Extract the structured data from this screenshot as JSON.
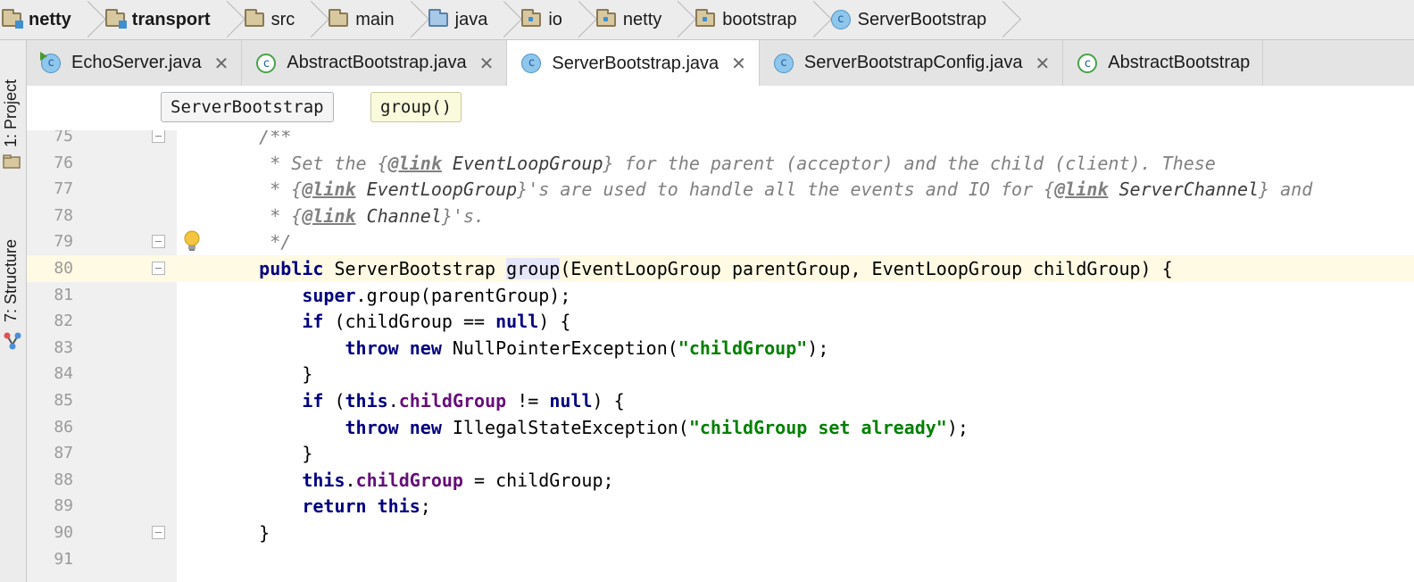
{
  "breadcrumb": [
    {
      "label": "netty",
      "icon": "module-folder-icon",
      "bold": true
    },
    {
      "label": "transport",
      "icon": "module-folder-icon",
      "bold": true
    },
    {
      "label": "src",
      "icon": "folder-icon"
    },
    {
      "label": "main",
      "icon": "folder-icon"
    },
    {
      "label": "java",
      "icon": "source-folder-icon"
    },
    {
      "label": "io",
      "icon": "package-icon"
    },
    {
      "label": "netty",
      "icon": "package-icon"
    },
    {
      "label": "bootstrap",
      "icon": "package-icon"
    },
    {
      "label": "ServerBootstrap",
      "icon": "class-icon"
    }
  ],
  "tool_windows": {
    "project": "1: Project",
    "structure": "7: Structure"
  },
  "tabs": [
    {
      "label": "EchoServer.java",
      "icon": "runnable-class-icon",
      "active": false
    },
    {
      "label": "AbstractBootstrap.java",
      "icon": "abstract-class-icon",
      "active": false
    },
    {
      "label": "ServerBootstrap.java",
      "icon": "class-icon",
      "active": true
    },
    {
      "label": "ServerBootstrapConfig.java",
      "icon": "class-icon",
      "active": false
    },
    {
      "label": "AbstractBootstrap",
      "icon": "abstract-class-icon",
      "active": false
    }
  ],
  "context": {
    "class_name": "ServerBootstrap",
    "method_name": "group()"
  },
  "editor": {
    "current_line": 80,
    "lines": [
      {
        "n": "75",
        "segs": [
          {
            "t": "    /**",
            "c": "cmt"
          }
        ]
      },
      {
        "n": "76",
        "segs": [
          {
            "t": "     * Set the {",
            "c": "cmt"
          },
          {
            "t": "@link",
            "c": "tag"
          },
          {
            "t": " ",
            "c": "cmt"
          },
          {
            "t": "EventLoopGroup",
            "c": "ref"
          },
          {
            "t": "} for the parent (acceptor) and the child (client). These",
            "c": "cmt"
          }
        ]
      },
      {
        "n": "77",
        "segs": [
          {
            "t": "     * {",
            "c": "cmt"
          },
          {
            "t": "@link",
            "c": "tag"
          },
          {
            "t": " ",
            "c": "cmt"
          },
          {
            "t": "EventLoopGroup",
            "c": "ref"
          },
          {
            "t": "}'s are used to handle all the events and IO for {",
            "c": "cmt"
          },
          {
            "t": "@link",
            "c": "tag"
          },
          {
            "t": " ",
            "c": "cmt"
          },
          {
            "t": "ServerChannel",
            "c": "ref"
          },
          {
            "t": "} and",
            "c": "cmt"
          }
        ]
      },
      {
        "n": "78",
        "segs": [
          {
            "t": "     * {",
            "c": "cmt"
          },
          {
            "t": "@link",
            "c": "tag"
          },
          {
            "t": " ",
            "c": "cmt"
          },
          {
            "t": "Channel",
            "c": "ref"
          },
          {
            "t": "}'s.",
            "c": "cmt"
          }
        ]
      },
      {
        "n": "79",
        "segs": [
          {
            "t": "     */",
            "c": "cmt"
          }
        ]
      },
      {
        "n": "80",
        "segs": [
          {
            "t": "    ",
            "c": ""
          },
          {
            "t": "public",
            "c": "kw"
          },
          {
            "t": " ServerBootstrap ",
            "c": ""
          },
          {
            "t": "group",
            "c": "usage"
          },
          {
            "t": "(EventLoopGroup parentGroup, EventLoopGroup childGroup) {",
            "c": ""
          }
        ]
      },
      {
        "n": "81",
        "segs": [
          {
            "t": "        ",
            "c": ""
          },
          {
            "t": "super",
            "c": "kw"
          },
          {
            "t": ".group(parentGroup);",
            "c": ""
          }
        ]
      },
      {
        "n": "82",
        "segs": [
          {
            "t": "        ",
            "c": ""
          },
          {
            "t": "if",
            "c": "kw"
          },
          {
            "t": " (childGroup == ",
            "c": ""
          },
          {
            "t": "null",
            "c": "kw"
          },
          {
            "t": ") {",
            "c": ""
          }
        ]
      },
      {
        "n": "83",
        "segs": [
          {
            "t": "            ",
            "c": ""
          },
          {
            "t": "throw new",
            "c": "kw"
          },
          {
            "t": " NullPointerException(",
            "c": ""
          },
          {
            "t": "\"childGroup\"",
            "c": "str"
          },
          {
            "t": ");",
            "c": ""
          }
        ]
      },
      {
        "n": "84",
        "segs": [
          {
            "t": "        }",
            "c": ""
          }
        ]
      },
      {
        "n": "85",
        "segs": [
          {
            "t": "        ",
            "c": ""
          },
          {
            "t": "if",
            "c": "kw"
          },
          {
            "t": " (",
            "c": ""
          },
          {
            "t": "this",
            "c": "kw"
          },
          {
            "t": ".",
            "c": ""
          },
          {
            "t": "childGroup",
            "c": "fld"
          },
          {
            "t": " != ",
            "c": ""
          },
          {
            "t": "null",
            "c": "kw"
          },
          {
            "t": ") {",
            "c": ""
          }
        ]
      },
      {
        "n": "86",
        "segs": [
          {
            "t": "            ",
            "c": ""
          },
          {
            "t": "throw new",
            "c": "kw"
          },
          {
            "t": " IllegalStateException(",
            "c": ""
          },
          {
            "t": "\"childGroup set already\"",
            "c": "str"
          },
          {
            "t": ");",
            "c": ""
          }
        ]
      },
      {
        "n": "87",
        "segs": [
          {
            "t": "        }",
            "c": ""
          }
        ]
      },
      {
        "n": "88",
        "segs": [
          {
            "t": "        ",
            "c": ""
          },
          {
            "t": "this",
            "c": "kw"
          },
          {
            "t": ".",
            "c": ""
          },
          {
            "t": "childGroup",
            "c": "fld"
          },
          {
            "t": " = childGroup;",
            "c": ""
          }
        ]
      },
      {
        "n": "89",
        "segs": [
          {
            "t": "        ",
            "c": ""
          },
          {
            "t": "return this",
            "c": "kw"
          },
          {
            "t": ";",
            "c": ""
          }
        ]
      },
      {
        "n": "90",
        "segs": [
          {
            "t": "    }",
            "c": ""
          }
        ]
      },
      {
        "n": "91",
        "segs": []
      }
    ]
  },
  "colors": {
    "keyword": "#000080",
    "string": "#008000",
    "comment": "#808080",
    "field": "#660e7a",
    "current_line": "#fffae3",
    "usage_highlight": "#e6e6fa"
  }
}
